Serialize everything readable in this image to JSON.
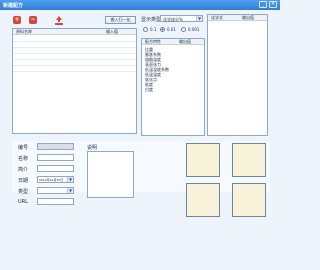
{
  "window": {
    "title": "新建配方"
  },
  "toolbar": {
    "add_icon": "plus-icon",
    "remove_icon": "minus-icon",
    "save_icon": "save-icon",
    "import_button_label": "输入归一化"
  },
  "display": {
    "type_label": "显示类型",
    "type_value": "化学成分%",
    "radio_options": [
      "0.1",
      "0.01",
      "0.001"
    ],
    "selected_radio": "0.01"
  },
  "raw_table": {
    "columns": [
      "原料名称",
      "输入值"
    ]
  },
  "property_table": {
    "columns": [
      "配方特性",
      "输出值"
    ],
    "rows": [
      "比重",
      "膨胀系数",
      "熔融温度",
      "表面张力",
      "低温温度系数",
      "低温温度",
      "软化点",
      "粘度",
      "白度"
    ]
  },
  "right_table": {
    "columns": [
      "化学式",
      "输出值"
    ]
  },
  "form": {
    "number_label": "编号",
    "name_label": "名称",
    "description_label": "简介",
    "date_label": "日期",
    "date_value": "2012年10月25日",
    "category_label": "类型",
    "url_label": "URL",
    "notes_label": "说明"
  },
  "colors": {
    "title_bar": "#3f8fe8",
    "panel_border": "#8fa9c8",
    "photo_fill": "#f7f2d8",
    "icon_red": "#d9473b"
  }
}
